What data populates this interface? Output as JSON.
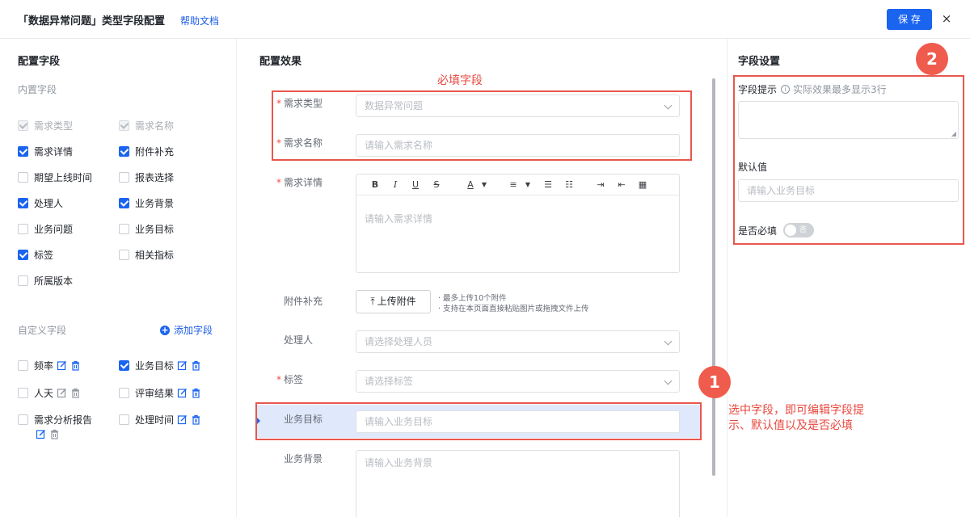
{
  "header": {
    "title": "「数据异常问题」类型字段配置",
    "help_label": "帮助文档",
    "save_label": "保 存",
    "close_label": "×"
  },
  "left": {
    "title": "配置字段",
    "builtin_label": "内置字段",
    "builtin_fields": [
      {
        "label": "需求类型",
        "state": "disabled"
      },
      {
        "label": "需求名称",
        "state": "disabled"
      },
      {
        "label": "需求详情",
        "state": "checked"
      },
      {
        "label": "附件补充",
        "state": "checked"
      },
      {
        "label": "期望上线时间",
        "state": "unchecked"
      },
      {
        "label": "报表选择",
        "state": "unchecked"
      },
      {
        "label": "处理人",
        "state": "checked"
      },
      {
        "label": "业务背景",
        "state": "checked"
      },
      {
        "label": "业务问题",
        "state": "unchecked"
      },
      {
        "label": "业务目标",
        "state": "unchecked"
      },
      {
        "label": "标签",
        "state": "checked"
      },
      {
        "label": "相关指标",
        "state": "unchecked"
      },
      {
        "label": "所属版本",
        "state": "unchecked"
      }
    ],
    "custom_label": "自定义字段",
    "add_field_label": "添加字段",
    "custom_fields": [
      {
        "label": "频率",
        "state": "unchecked"
      },
      {
        "label": "业务目标",
        "state": "checked"
      },
      {
        "label": "人天",
        "state": "unchecked"
      },
      {
        "label": "评审结果",
        "state": "unchecked"
      },
      {
        "label": "需求分析报告",
        "state": "unchecked"
      },
      {
        "label": "处理时间",
        "state": "unchecked"
      }
    ]
  },
  "middle": {
    "title": "配置效果",
    "required_annotation": "必填字段",
    "fields": {
      "type": {
        "label": "需求类型",
        "value": "数据异常问题"
      },
      "name": {
        "label": "需求名称",
        "placeholder": "请输入需求名称"
      },
      "detail": {
        "label": "需求详情",
        "placeholder": "请输入需求详情"
      },
      "attach": {
        "label": "附件补充",
        "button": "上传附件",
        "hint1": "· 最多上传10个附件",
        "hint2": "· 支持在本页面直接粘贴图片或拖拽文件上传"
      },
      "handler": {
        "label": "处理人",
        "placeholder": "请选择处理人员"
      },
      "tag": {
        "label": "标签",
        "placeholder": "请选择标签"
      },
      "goal": {
        "label": "业务目标",
        "placeholder": "请输入业务目标"
      },
      "background": {
        "label": "业务背景",
        "placeholder": "请输入业务背景"
      }
    },
    "required_mark": "*"
  },
  "annotations": {
    "badge1": "1",
    "badge2": "2",
    "note_line1": "选中字段，即可编辑字段提",
    "note_line2": "示、默认值以及是否必填"
  },
  "right": {
    "title": "字段设置",
    "hint_label": "字段提示",
    "hint_note": "实际效果最多显示3行",
    "default_label": "默认值",
    "default_placeholder": "请输入业务目标",
    "required_label": "是否必填",
    "toggle_text": "否"
  },
  "colors": {
    "accent": "#1a64f0",
    "annotation": "#e8574e",
    "highlight": "#dfe9fb"
  }
}
